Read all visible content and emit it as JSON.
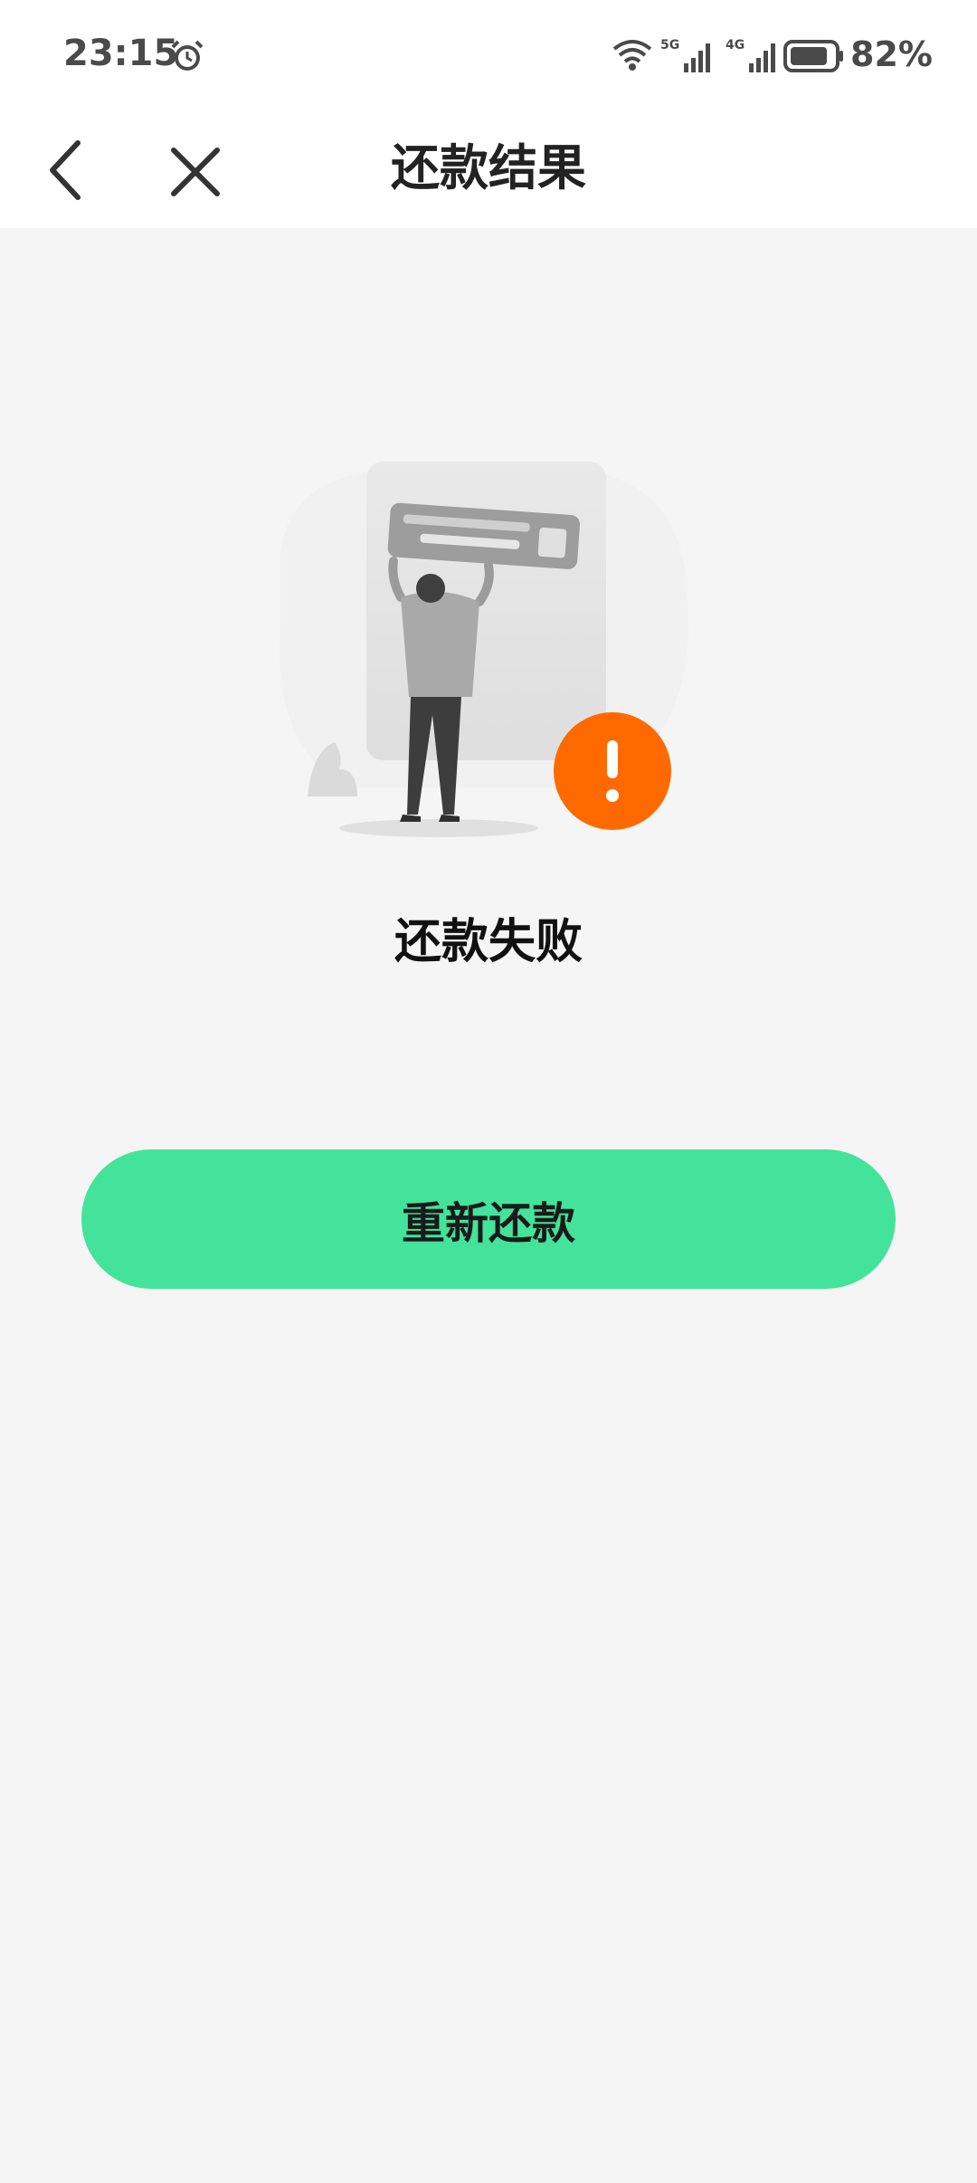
{
  "status_bar": {
    "time": "23:15",
    "battery": "82%",
    "network_5g": "5G",
    "network_4g": "4G"
  },
  "nav": {
    "title": "还款结果"
  },
  "result": {
    "status_text": "还款失败",
    "status_color": "#ff6a00"
  },
  "actions": {
    "retry_label": "重新还款",
    "retry_color": "#43e39b"
  },
  "icons": {
    "back": "chevron-left-icon",
    "close": "close-icon",
    "alarm": "alarm-clock-icon",
    "wifi": "wifi-icon",
    "signal": "cellular-signal-icon",
    "battery": "battery-icon",
    "warning": "exclamation-icon"
  }
}
